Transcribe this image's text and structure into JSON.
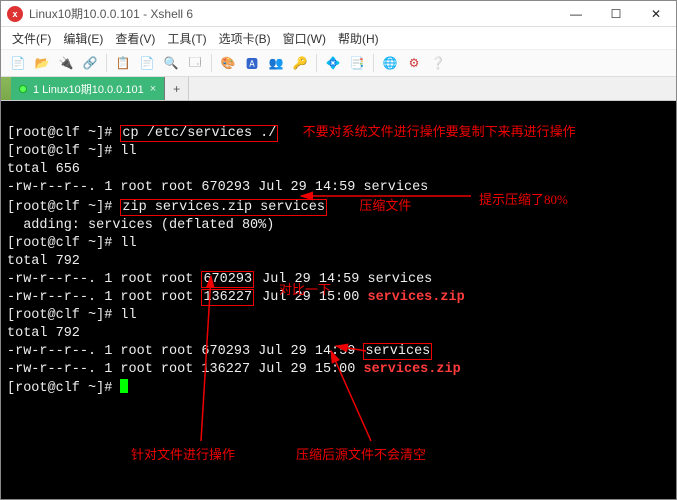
{
  "window": {
    "title": "Linux10期10.0.0.101 - Xshell 6",
    "min": "—",
    "max": "☐",
    "close": "✕"
  },
  "menu": {
    "file": "文件(F)",
    "edit": "编辑(E)",
    "view": "查看(V)",
    "tools": "工具(T)",
    "tab": "选项卡(B)",
    "window": "窗口(W)",
    "help": "帮助(H)"
  },
  "tab": {
    "label": "1 Linux10期10.0.0.101",
    "close": "×",
    "add": "+"
  },
  "prompt": "[root@clf ~]# ",
  "term": {
    "l1_cmd": "cp /etc/services ./",
    "l2_cmd": "ll",
    "l3": "total 656",
    "l4": "-rw-r--r--. 1 root root 670293 Jul 29 14:59 services",
    "l5_cmd": "zip services.zip services",
    "l6": "  adding: services (deflated 80%)",
    "l7_cmd": "ll",
    "l8": "total 792",
    "l9a": "-rw-r--r--. 1 root root ",
    "l9b": "670293",
    "l9c": " Jul 29 14:59 services",
    "l10a": "-rw-r--r--. 1 root root ",
    "l10b": "136227",
    "l10c": " Jul 29 15:00 ",
    "l10d": "services.zip",
    "l11_cmd": "ll",
    "l12": "total 792",
    "l13a": "-rw-r--r--. 1 root root 670293 Jul 29 14:59 ",
    "l13b": "services",
    "l14a": "-rw-r--r--. 1 root root 136227 Jul 29 15:00 ",
    "l14b": "services.zip"
  },
  "anno": {
    "a1": "不要对系统文件进行操作要复制下来再进行操作",
    "a2": "压缩文件",
    "a3": "提示压缩了80%",
    "a4": "对比一下",
    "a5": "针对文件进行操作",
    "a6": "压缩后源文件不会清空"
  }
}
